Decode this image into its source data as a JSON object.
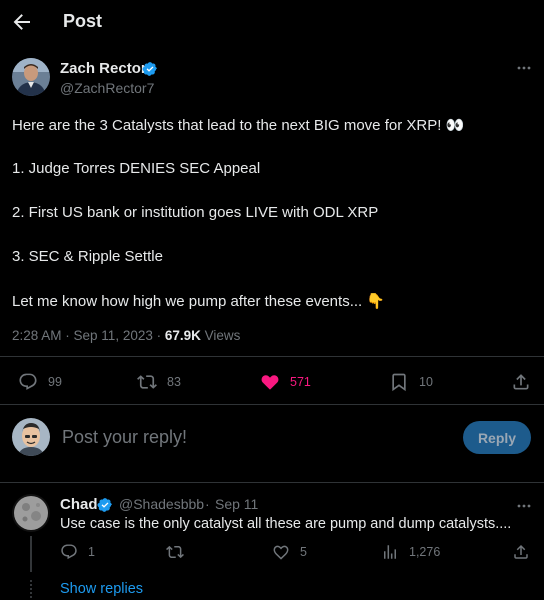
{
  "header": {
    "title": "Post",
    "back_icon": "arrow-left-icon"
  },
  "tweet": {
    "author_name": "Zach Rector",
    "author_handle": "@ZachRector7",
    "verified": true,
    "lines": [
      "Here are the 3 Catalysts that lead to the next BIG move for XRP! 👀",
      "1. Judge Torres DENIES SEC Appeal",
      "2. First US bank or institution goes LIVE with ODL XRP",
      "3. SEC & Ripple Settle",
      "Let me know how high we pump after these events... 👇"
    ],
    "timestamp": "2:28 AM · Sep 11, 2023 · ",
    "views_count": "67.9K",
    "views_label": " Views",
    "stats": {
      "replies": "99",
      "reposts": "83",
      "likes": "571",
      "bookmarks": "10"
    }
  },
  "compose": {
    "placeholder": "Post your reply!",
    "reply_button": "Reply"
  },
  "reply": {
    "author_name": "Chad",
    "author_handle": "@Shadesbbb",
    "separator": "·",
    "date": "Sep 11",
    "text": "Use case is the only catalyst all these are pump and dump catalysts....",
    "stats": {
      "replies": "1",
      "reposts": "",
      "likes": "5",
      "views": "1,276"
    },
    "show_replies": "Show replies"
  },
  "colors": {
    "background": "#000000",
    "text": "#e7e9ea",
    "muted": "#71767b",
    "accent": "#1d9bf0",
    "like": "#f91880",
    "divider": "#2f3336",
    "reply_button_bg": "#1d5b8c"
  }
}
